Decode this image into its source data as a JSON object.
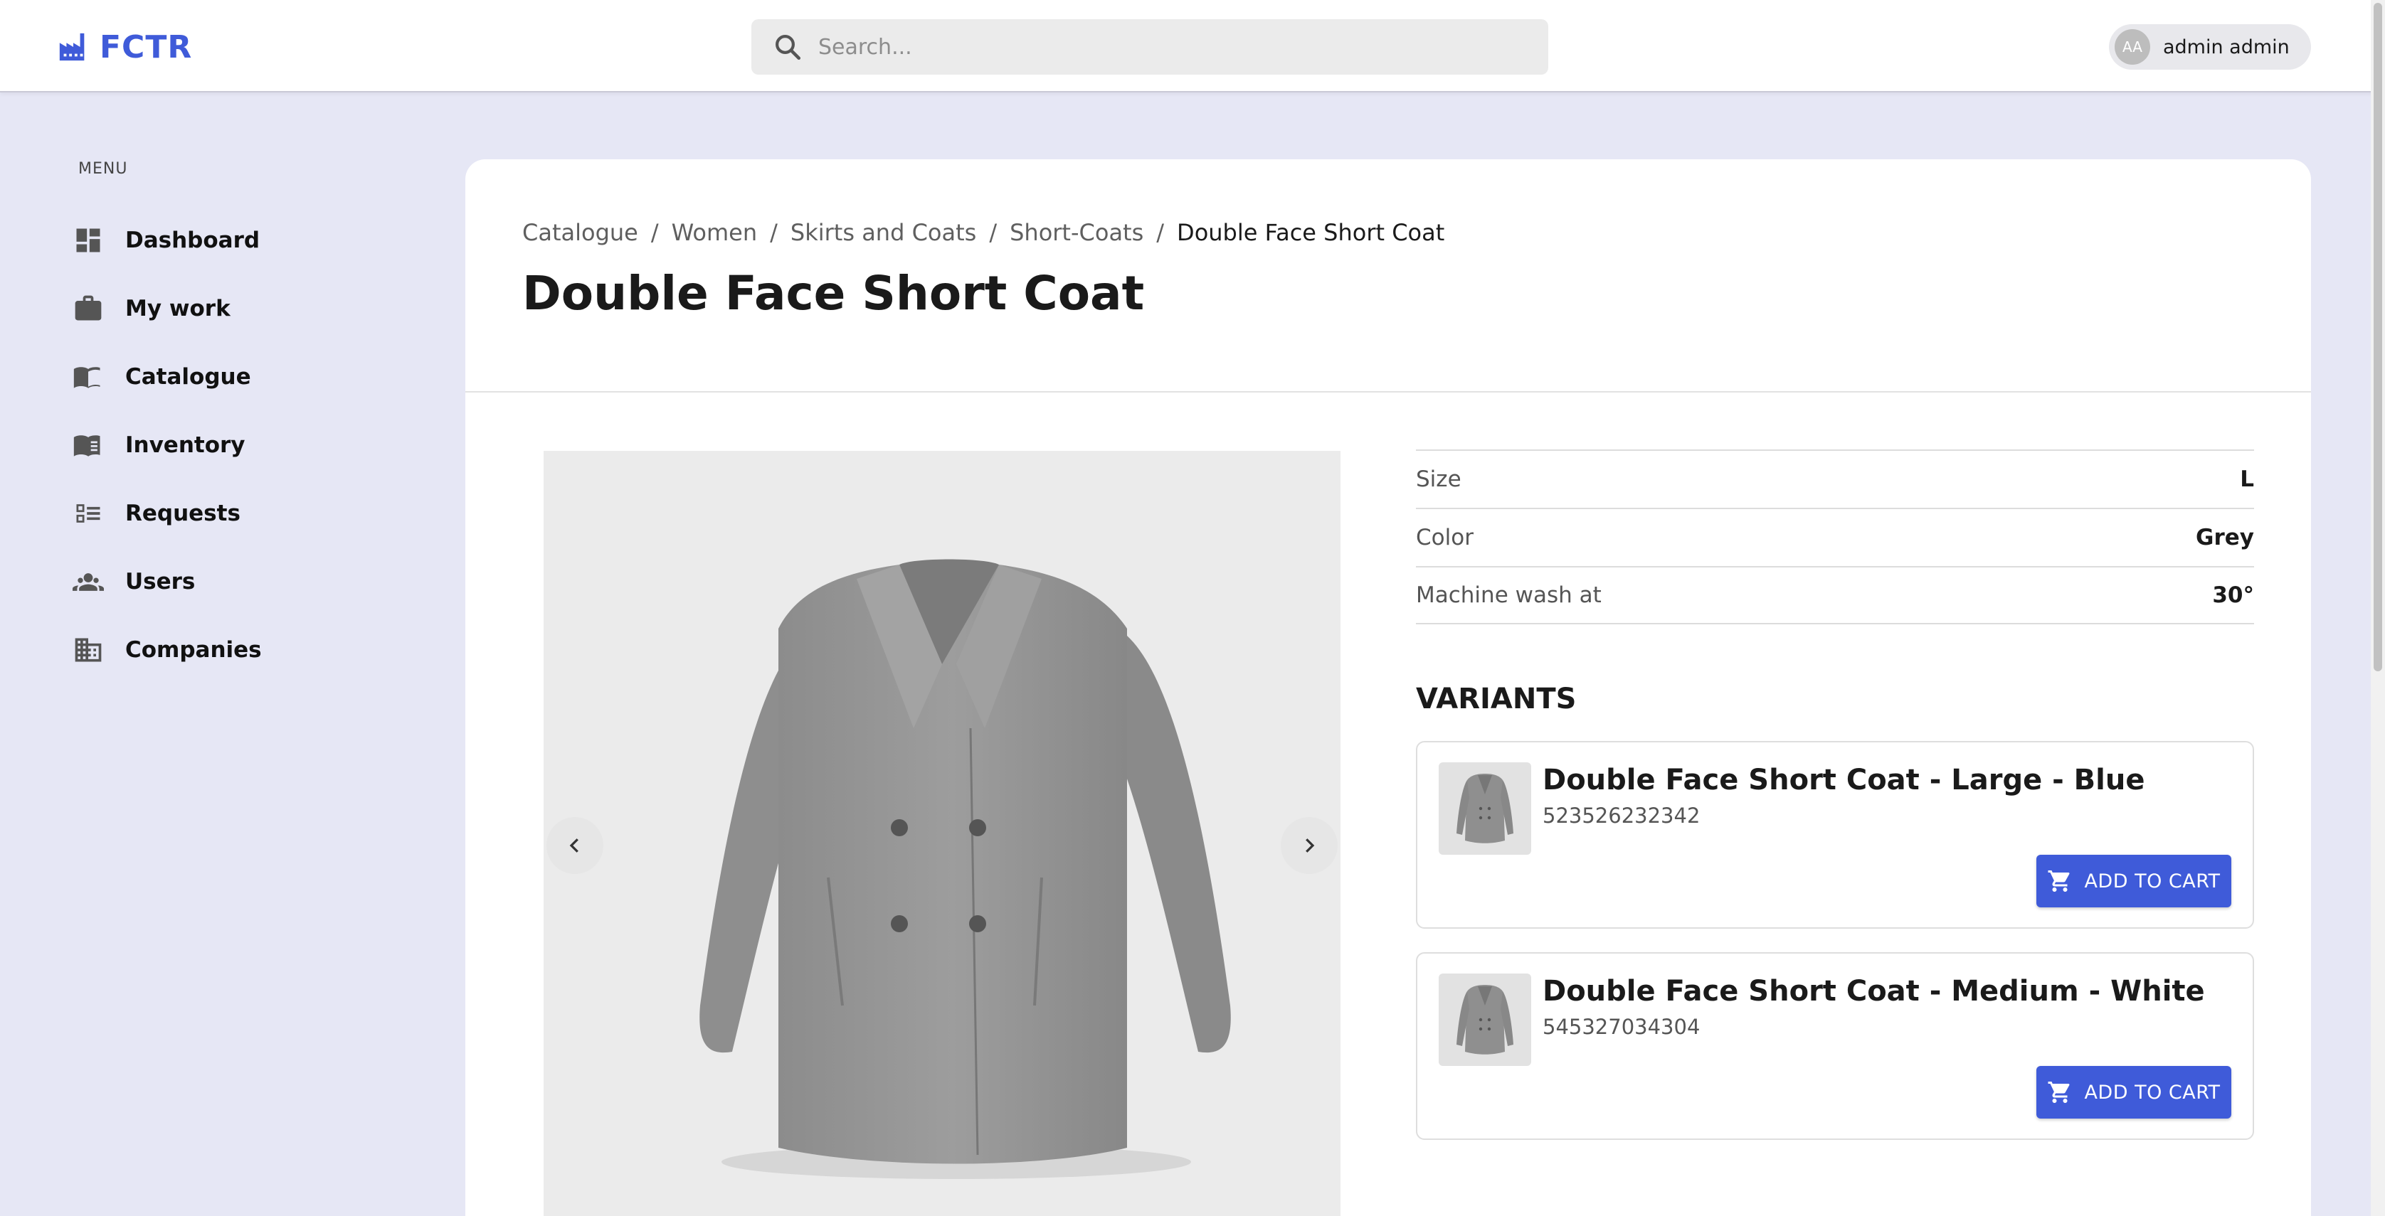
{
  "app": {
    "logo_text": "FCTR",
    "brand_color": "#3f5bd9"
  },
  "search": {
    "placeholder": "Search..."
  },
  "user": {
    "initials": "AA",
    "name": "admin admin"
  },
  "sidebar": {
    "heading": "MENU",
    "items": [
      {
        "label": "Dashboard",
        "icon": "dashboard-icon"
      },
      {
        "label": "My work",
        "icon": "briefcase-icon"
      },
      {
        "label": "Catalogue",
        "icon": "book-icon"
      },
      {
        "label": "Inventory",
        "icon": "ledger-icon"
      },
      {
        "label": "Requests",
        "icon": "checklist-icon"
      },
      {
        "label": "Users",
        "icon": "users-icon"
      },
      {
        "label": "Companies",
        "icon": "building-icon"
      }
    ]
  },
  "breadcrumb": [
    "Catalogue",
    "Women",
    "Skirts and Coats",
    "Short-Coats",
    "Double Face Short Coat"
  ],
  "product": {
    "title": "Double Face Short Coat",
    "attributes": [
      {
        "key": "Size",
        "value": "L"
      },
      {
        "key": "Color",
        "value": "Grey"
      },
      {
        "key": "Machine wash at",
        "value": "30°"
      }
    ]
  },
  "variants": {
    "heading": "VARIANTS",
    "items": [
      {
        "name": "Double Face Short Coat - Large - Blue",
        "sku": "523526232342",
        "button": "ADD TO CART"
      },
      {
        "name": "Double Face Short Coat - Medium - White",
        "sku": "545327034304",
        "button": "ADD TO CART"
      }
    ]
  }
}
